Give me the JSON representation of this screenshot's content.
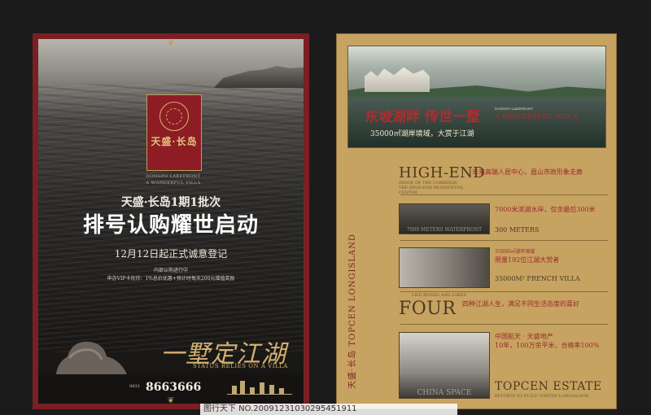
{
  "left_poster": {
    "logo_name": "天盛·长岛",
    "under_logo_line1": "DONGPO LAKEFRONT",
    "under_logo_line2": "A WONDERFUL VILLA",
    "line1": "天盛·长岛1期1批次",
    "headline": "排号认购耀世启动",
    "date_line": "12月12日起正式诚意登记",
    "small_line1": "内部认购进行中",
    "small_line2": "申办VIP卡优待：1%总价优惠+预计时每天200元增值奖励",
    "slogan": "一墅定江湖",
    "slogan_en": "STATUS RELIES ON A VILLA",
    "phone_prefix": "0833",
    "phone": "8663666"
  },
  "right_poster": {
    "hero_title": "东坡湖畔  传世一墅",
    "hero_en_small": "DONGPO LAKEFRONT",
    "hero_en": "A WONDERFUL VILLA",
    "hero_sub": "35000㎡湖岸境域，大赏于江湖",
    "s1_title": "HIGH-END",
    "s1_sub": "IMAGE OF THE CORRIDOR\nTHE HIGH-END RESIDENTIAL CENTER",
    "s1_red": "未来高端人居中心，眉山市政形象走廊",
    "s2_red": "7000米滨湖水岸，仅余最后300米",
    "s2_dark": "300 METERS",
    "s2_caption": "7000 METERS WATERFRONT",
    "s3_red_small": "35000㎡湖岸境域",
    "s3_red": "限量192位江湖大赏者",
    "s3_dark": "35000M² FRENCH VILLA",
    "s4_title": "FOUR",
    "s4_small": "LIFE RIVERS AND LAKES",
    "s4_red": "四种江湖人生，满足不同生活态度的喜好",
    "s5_red": "中国航天 · 天盛地产\n10年，100万余平米，合格率100%",
    "s5_title": "TOPCEN ESTATE",
    "s5_sub": "EFFORTS TO BUILD TOPCEN LONGISLAND",
    "s5_caption": "CHINA SPACE",
    "side_text": "天盛·长岛  TOPCEN LONGISLAND"
  },
  "watermark": "图行天下  NO.20091231030295451911"
}
